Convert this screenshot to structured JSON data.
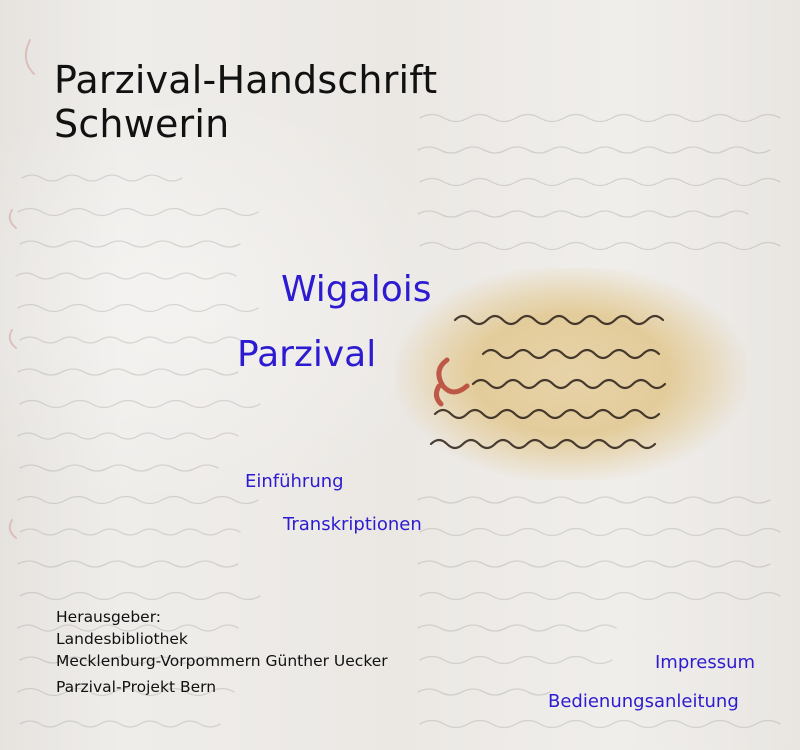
{
  "header": {
    "title_line1": "Parzival-Handschrift",
    "title_line2": "Schwerin"
  },
  "nav": {
    "wigalois": "Wigalois",
    "parzival": "Parzival",
    "einfuehrung": "Einführung",
    "transkriptionen": "Transkriptionen",
    "impressum": "Impressum",
    "bedienungsanleitung": "Bedienungsanleitung"
  },
  "publisher": {
    "label": "Herausgeber:",
    "line1": "Landesbibliothek",
    "line2": "Mecklenburg-Vorpommern Günther Uecker",
    "line3": "Parzival-Projekt Bern"
  },
  "colors": {
    "link": "#2c1bd0",
    "text": "#111111",
    "background": "#eceae7",
    "parchment": "#e3cc9b",
    "rubric": "#b3382c"
  },
  "images": {
    "background": "manuscript-page-background",
    "fragment": "highlighted-manuscript-fragment"
  }
}
